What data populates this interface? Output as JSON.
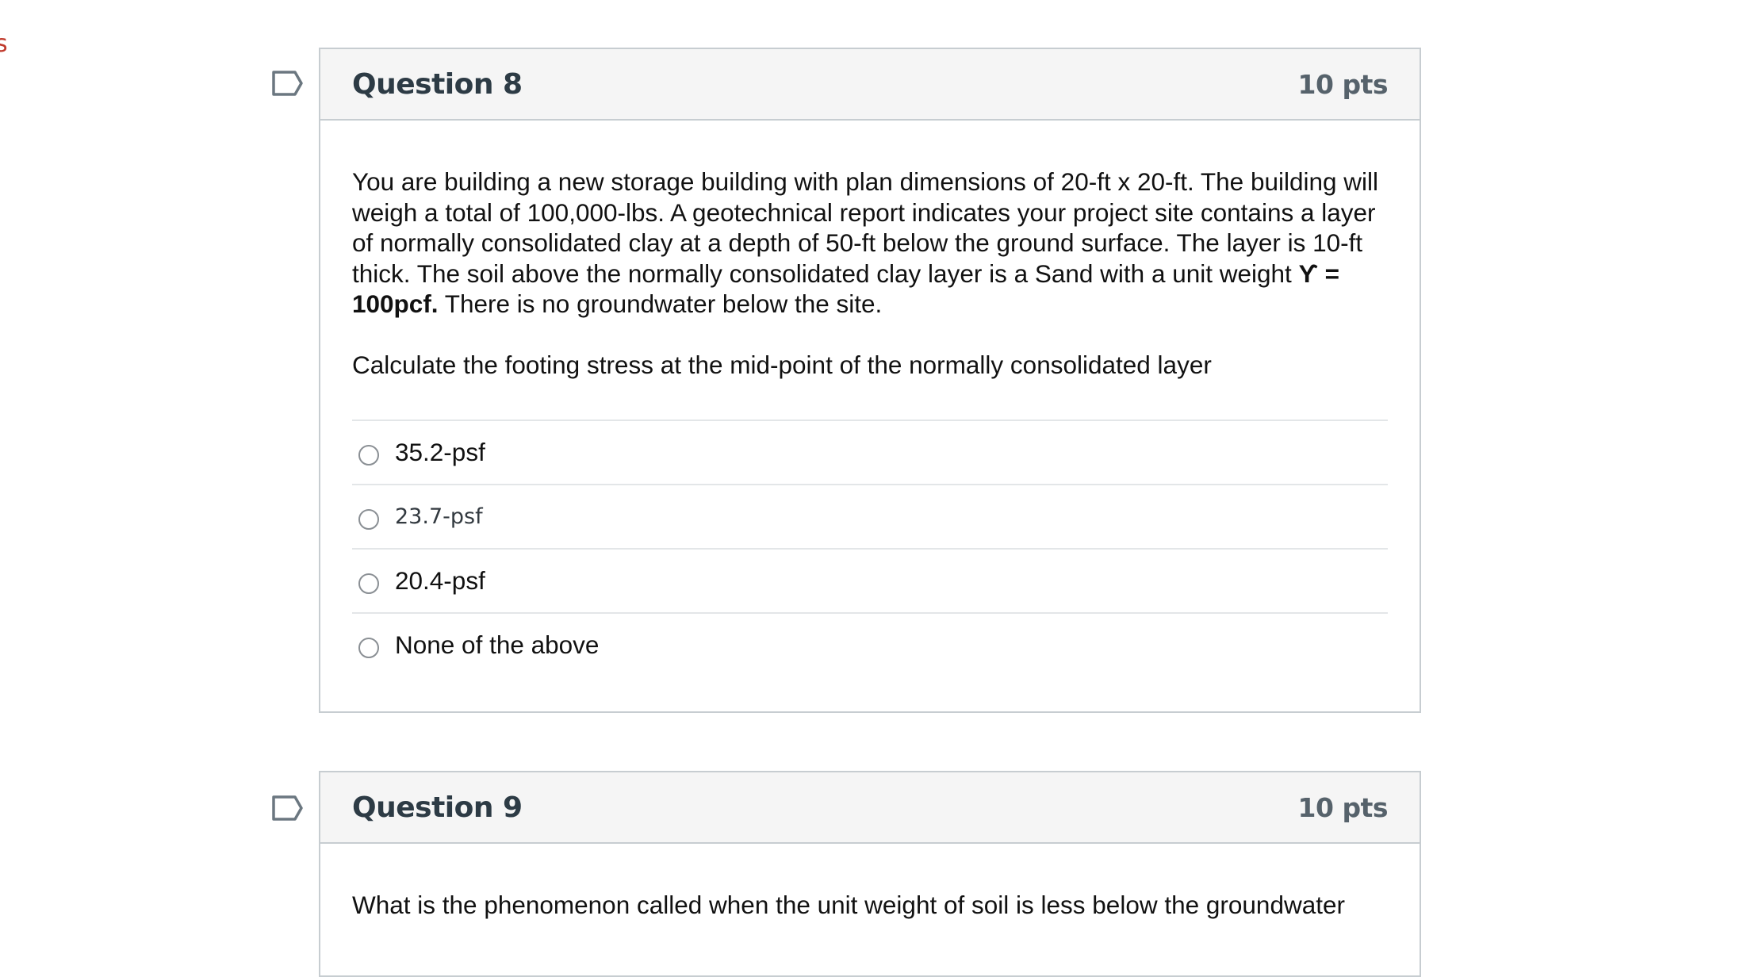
{
  "left_edge_glyph": "s",
  "questions": [
    {
      "title": "Question 8",
      "points": "10 pts",
      "text_before_bold": "You are building a new storage building with plan dimensions of 20-ft x 20-ft.  The building will weigh a total of 100,000-lbs.  A geotechnical report indicates your project site contains a layer of normally consolidated clay at a depth of 50-ft below the ground surface.  The layer is 10-ft thick.  The soil above the normally consolidated clay layer is a Sand with a unit weight ",
      "bold_text": "ϒ = 100pcf.",
      "text_after_bold": "  There is no groundwater below the site.",
      "prompt": "Calculate the footing stress at the mid-point of the normally consolidated layer",
      "answers": [
        {
          "label": "35.2-psf"
        },
        {
          "label": "23.7-psf"
        },
        {
          "label": "20.4-psf"
        },
        {
          "label": "None of the above"
        }
      ]
    },
    {
      "title": "Question 9",
      "points": "10 pts",
      "text_partial": "What is the phenomenon called when the unit weight of soil is less below the groundwater"
    }
  ]
}
